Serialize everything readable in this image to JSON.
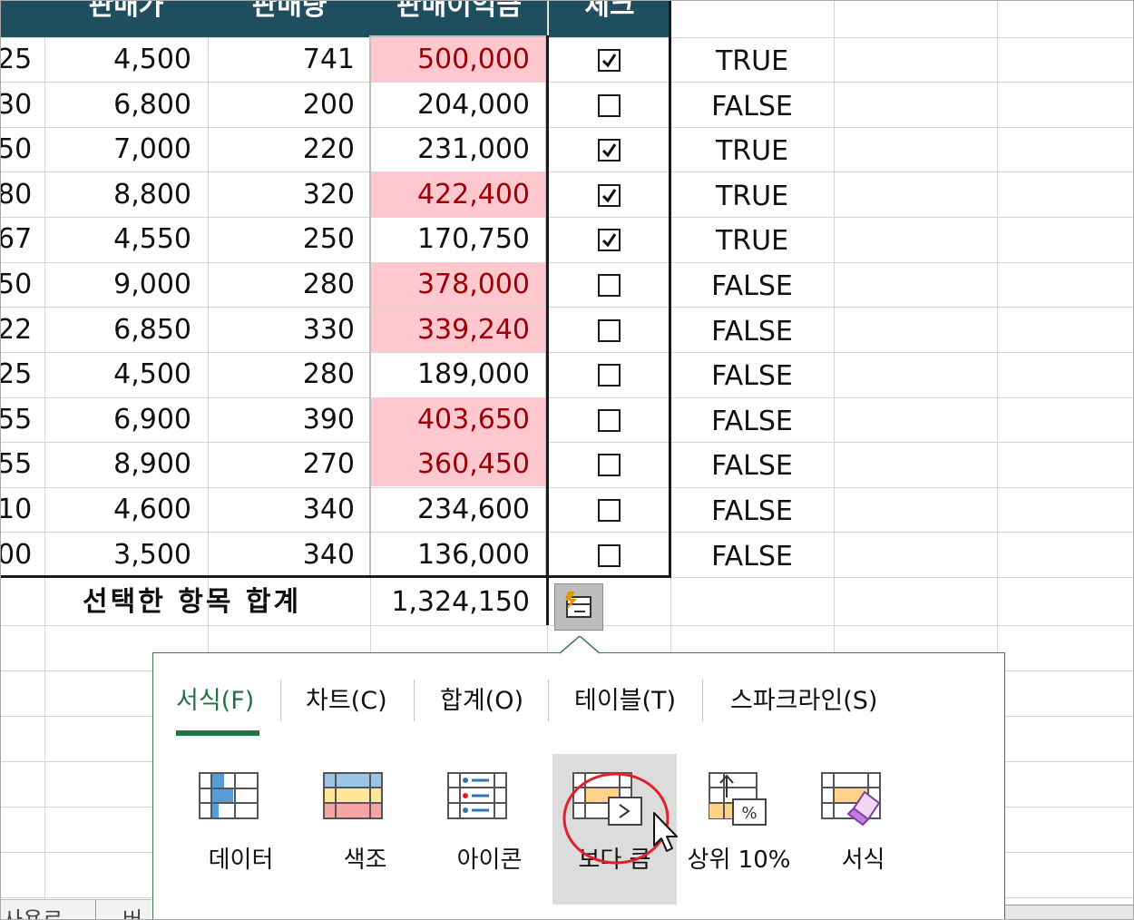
{
  "headers": {
    "col_a": "판매가",
    "col_b": "판매량",
    "col_c": "판매이익금",
    "col_d": "체크"
  },
  "rows": [
    {
      "left": "25",
      "price": "4,500",
      "qty": "741",
      "profit": "500,000",
      "highlight": true,
      "checked": true,
      "bool": "TRUE"
    },
    {
      "left": "30",
      "price": "6,800",
      "qty": "200",
      "profit": "204,000",
      "highlight": false,
      "checked": false,
      "bool": "FALSE"
    },
    {
      "left": "50",
      "price": "7,000",
      "qty": "220",
      "profit": "231,000",
      "highlight": false,
      "checked": true,
      "bool": "TRUE"
    },
    {
      "left": "80",
      "price": "8,800",
      "qty": "320",
      "profit": "422,400",
      "highlight": true,
      "checked": true,
      "bool": "TRUE"
    },
    {
      "left": "67",
      "price": "4,550",
      "qty": "250",
      "profit": "170,750",
      "highlight": false,
      "checked": true,
      "bool": "TRUE"
    },
    {
      "left": "50",
      "price": "9,000",
      "qty": "280",
      "profit": "378,000",
      "highlight": true,
      "checked": false,
      "bool": "FALSE"
    },
    {
      "left": "22",
      "price": "6,850",
      "qty": "330",
      "profit": "339,240",
      "highlight": true,
      "checked": false,
      "bool": "FALSE"
    },
    {
      "left": "25",
      "price": "4,500",
      "qty": "280",
      "profit": "189,000",
      "highlight": false,
      "checked": false,
      "bool": "FALSE"
    },
    {
      "left": "55",
      "price": "6,900",
      "qty": "390",
      "profit": "403,650",
      "highlight": true,
      "checked": false,
      "bool": "FALSE"
    },
    {
      "left": "55",
      "price": "8,900",
      "qty": "270",
      "profit": "360,450",
      "highlight": true,
      "checked": false,
      "bool": "FALSE"
    },
    {
      "left": "10",
      "price": "4,600",
      "qty": "340",
      "profit": "234,600",
      "highlight": false,
      "checked": false,
      "bool": "FALSE"
    },
    {
      "left": "00",
      "price": "3,500",
      "qty": "340",
      "profit": "136,000",
      "highlight": false,
      "checked": false,
      "bool": "FALSE"
    }
  ],
  "total": {
    "label": "선택한 항목 합계",
    "value": "1,324,150"
  },
  "quick_analysis": {
    "tabs": [
      {
        "label": "서식(F)",
        "active": true
      },
      {
        "label": "차트(C)",
        "active": false
      },
      {
        "label": "합계(O)",
        "active": false
      },
      {
        "label": "테이블(T)",
        "active": false
      },
      {
        "label": "스파크라인(S)",
        "active": false
      }
    ],
    "tools": [
      {
        "label": "데이터",
        "icon": "data-bar-icon"
      },
      {
        "label": "색조",
        "icon": "color-scale-icon"
      },
      {
        "label": "아이콘",
        "icon": "icon-set-icon"
      },
      {
        "label": "보다 큼",
        "icon": "greater-than-icon",
        "hovered": true
      },
      {
        "label": "상위 10%",
        "icon": "top-10-percent-icon"
      },
      {
        "label": "서식",
        "icon": "clear-format-icon"
      }
    ]
  },
  "sheet_tabs": [
    "사용료",
    "버"
  ],
  "colors": {
    "header_bg": "#1f4e5f",
    "highlight_fill": "#ffc7ce",
    "highlight_text": "#9c0006",
    "accent_green": "#217346",
    "annotation_red": "#e0202a"
  }
}
